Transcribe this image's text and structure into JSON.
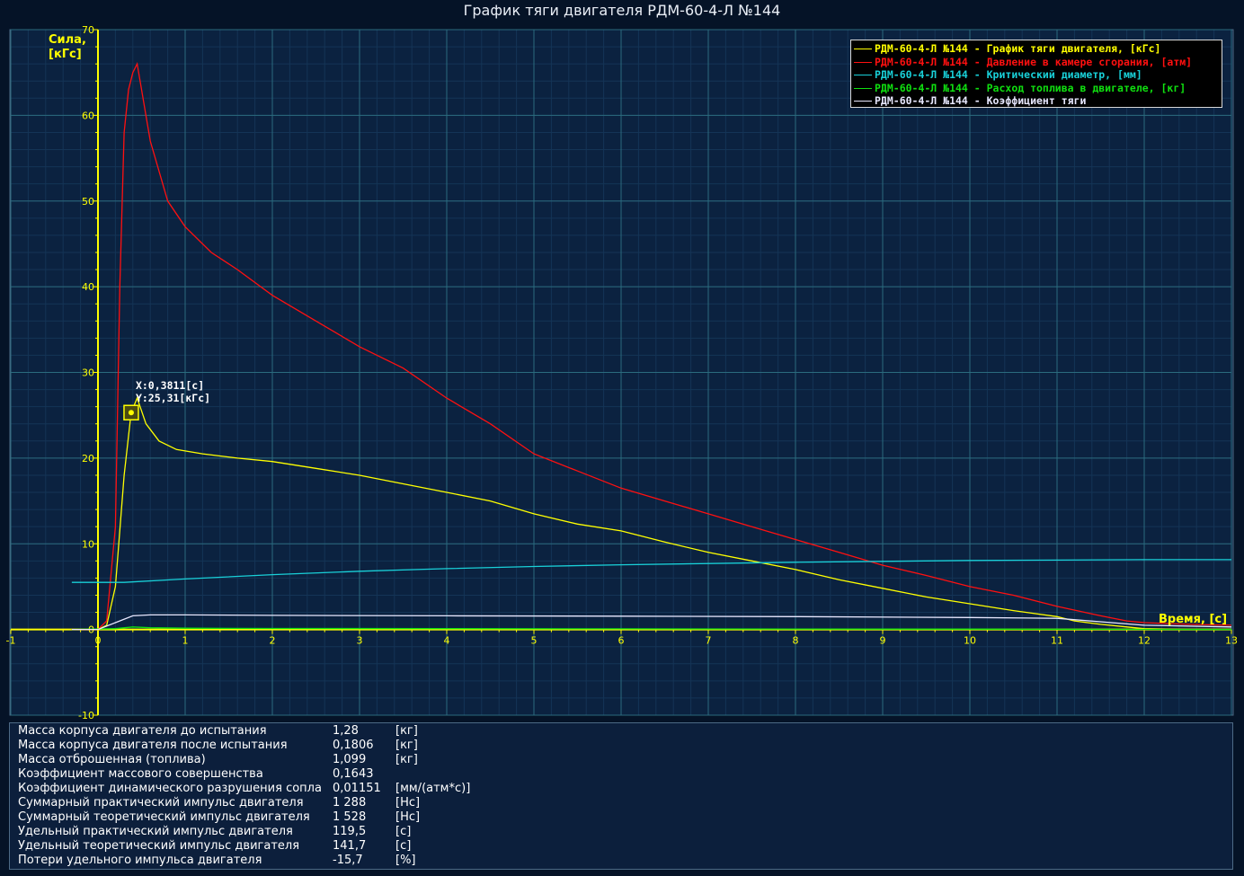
{
  "window": {
    "title": "График тяги двигателя РДМ-60-4-Л №144"
  },
  "chart_data": {
    "type": "line",
    "title": "График тяги двигателя РДМ-60-4-Л №144",
    "xlabel": "Время, [с]",
    "ylabel": "Сила, [кГс]",
    "xlim": [
      -1,
      13
    ],
    "ylim": [
      -10,
      70
    ],
    "xticks": [
      "-1",
      "0",
      "1",
      "2",
      "3",
      "4",
      "5",
      "6",
      "7",
      "8",
      "9",
      "10",
      "11",
      "12",
      "13"
    ],
    "yticks": [
      "-10",
      "0",
      "10",
      "20",
      "30",
      "40",
      "50",
      "60",
      "70"
    ],
    "grid": true,
    "legend_position": "top-right",
    "cursor": {
      "x": 0.3811,
      "y": 25.31,
      "x_label": "X:0,3811[с]",
      "y_label": "Y:25,31[кГс]"
    },
    "series": [
      {
        "name": "РДМ-60-4-Л №144 - График тяги двигателя, [кГс]",
        "color": "#ffff00",
        "x": [
          -0.3,
          0,
          0.1,
          0.2,
          0.3,
          0.38,
          0.45,
          0.55,
          0.7,
          0.9,
          1.2,
          1.6,
          2,
          2.5,
          3,
          3.5,
          4,
          4.5,
          5,
          5.5,
          6,
          6.5,
          7,
          7.5,
          8,
          8.5,
          9,
          9.5,
          10,
          10.5,
          11,
          11.2,
          11.5,
          11.8,
          12,
          12.5,
          13
        ],
        "values": [
          0,
          0,
          0.5,
          5,
          18,
          25.3,
          27,
          24,
          22,
          21,
          20.5,
          20,
          19.6,
          18.8,
          18,
          17,
          16,
          15,
          13.5,
          12.3,
          11.5,
          10.2,
          9,
          8,
          7,
          5.8,
          4.8,
          3.8,
          3,
          2.2,
          1.5,
          1,
          0.6,
          0.3,
          0.1,
          0,
          0
        ]
      },
      {
        "name": "РДМ-60-4-Л №144 - Давление в камере сгорания, [атм]",
        "color": "#ff1010",
        "x": [
          -0.3,
          0,
          0.1,
          0.2,
          0.25,
          0.3,
          0.35,
          0.4,
          0.45,
          0.5,
          0.6,
          0.8,
          1,
          1.3,
          1.6,
          2,
          2.5,
          3,
          3.5,
          4,
          4.5,
          5,
          5.5,
          6,
          6.5,
          7,
          7.5,
          8,
          8.5,
          9,
          9.5,
          10,
          10.5,
          11,
          11.5,
          11.8,
          12,
          12.5,
          13
        ],
        "values": [
          0,
          0,
          1,
          12,
          40,
          58,
          63,
          65,
          66,
          63,
          57,
          50,
          47,
          44,
          42,
          39,
          36,
          33,
          30.5,
          27,
          24,
          20.5,
          18.5,
          16.5,
          15,
          13.5,
          12,
          10.5,
          9,
          7.5,
          6.3,
          5,
          4,
          2.7,
          1.6,
          1,
          0.8,
          0.6,
          0.5
        ]
      },
      {
        "name": "РДМ-60-4-Л №144 - Критический диаметр, [мм]",
        "color": "#19d0d8",
        "x": [
          -0.3,
          0.3,
          1,
          2,
          3,
          4,
          5,
          6,
          7,
          8,
          9,
          10,
          11,
          12,
          13
        ],
        "values": [
          5.5,
          5.5,
          5.9,
          6.4,
          6.8,
          7.1,
          7.35,
          7.55,
          7.7,
          7.85,
          7.95,
          8.05,
          8.1,
          8.15,
          8.15
        ]
      },
      {
        "name": "РДМ-60-4-Л №144 - Расход топлива в двигателе, [кг]",
        "color": "#10e010",
        "x": [
          -0.3,
          0.2,
          0.4,
          0.6,
          1,
          2,
          4,
          6,
          8,
          10,
          11.5,
          13
        ],
        "values": [
          0,
          0.1,
          0.3,
          0.2,
          0.15,
          0.12,
          0.1,
          0.08,
          0.06,
          0.04,
          0.02,
          0
        ]
      },
      {
        "name": "РДМ-60-4-Л №144 - Коэффициент тяги",
        "color": "#e8e8ff",
        "x": [
          -0.3,
          0,
          0.2,
          0.4,
          0.6,
          1,
          2,
          4,
          6,
          8,
          10,
          11,
          12,
          13
        ],
        "values": [
          0,
          0,
          0.8,
          1.6,
          1.7,
          1.7,
          1.65,
          1.6,
          1.55,
          1.5,
          1.4,
          1.3,
          0.5,
          0.3
        ]
      }
    ]
  },
  "info_rows": [
    {
      "label": "Масса корпуса двигателя до испытания",
      "value": "1,28",
      "unit": "[кг]"
    },
    {
      "label": "Масса корпуса двигателя после испытания",
      "value": "0,1806",
      "unit": "[кг]"
    },
    {
      "label": "Масса отброшенная (топлива)",
      "value": "1,099",
      "unit": "[кг]"
    },
    {
      "label": "Коэффициент массового совершенства",
      "value": "0,1643",
      "unit": ""
    },
    {
      "label": "Коэффициент динамического разрушения сопла",
      "value": "0,01151",
      "unit": "[мм/(атм*с)]"
    },
    {
      "label": "Суммарный практический импульс двигателя",
      "value": "1 288",
      "unit": "[Нс]"
    },
    {
      "label": "Суммарный теоретический импульс двигателя",
      "value": "1 528",
      "unit": "[Нс]"
    },
    {
      "label": "Удельный практический импульс двигателя",
      "value": "119,5",
      "unit": "[с]"
    },
    {
      "label": "Удельный теоретический импульс двигателя",
      "value": "141,7",
      "unit": "[с]"
    },
    {
      "label": "Потери удельного импульса двигателя",
      "value": "-15,7",
      "unit": "[%]"
    }
  ]
}
